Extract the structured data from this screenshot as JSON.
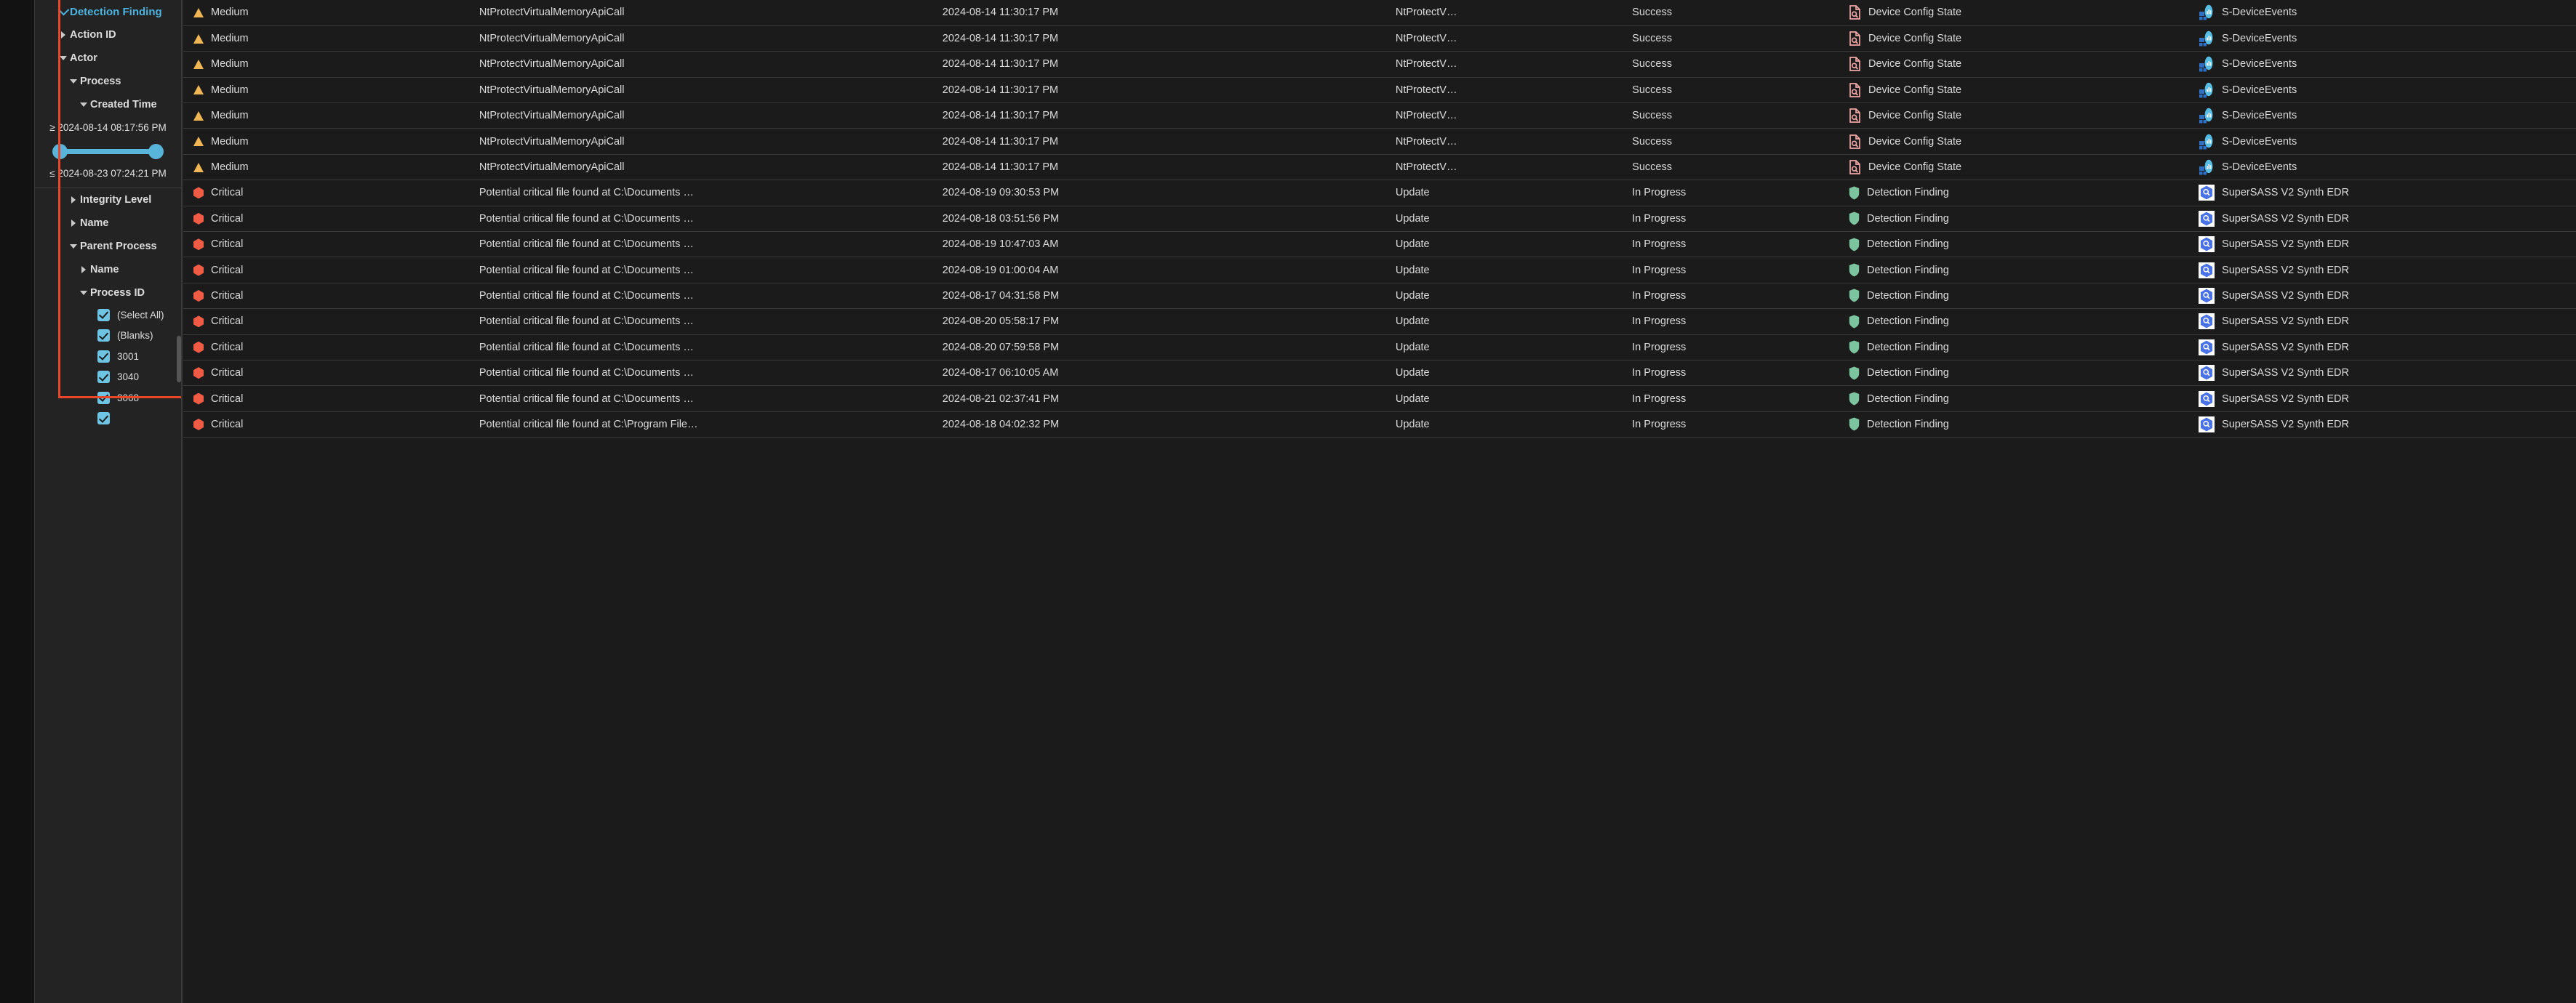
{
  "sidebar": {
    "tree": [
      {
        "id": "detection-finding",
        "label": "Detection Finding",
        "state": "expanded-root",
        "indent": 0
      },
      {
        "id": "action-id",
        "label": "Action ID",
        "state": "collapsed",
        "indent": 0
      },
      {
        "id": "actor",
        "label": "Actor",
        "state": "expanded",
        "indent": 0
      },
      {
        "id": "process",
        "label": "Process",
        "state": "expanded",
        "indent": 1
      },
      {
        "id": "created-time",
        "label": "Created Time",
        "state": "expanded",
        "indent": 2
      }
    ],
    "date_filter": {
      "min_label": "≥ 2024-08-14 08:17:56 PM",
      "max_label": "≤ 2024-08-23 07:24:21 PM"
    },
    "tree_after": [
      {
        "id": "integrity-level",
        "label": "Integrity Level",
        "state": "collapsed",
        "indent": 1
      },
      {
        "id": "name",
        "label": "Name",
        "state": "collapsed",
        "indent": 1
      },
      {
        "id": "parent-process",
        "label": "Parent Process",
        "state": "expanded",
        "indent": 1
      },
      {
        "id": "parent-name",
        "label": "Name",
        "state": "collapsed",
        "indent": 2
      },
      {
        "id": "process-id",
        "label": "Process ID",
        "state": "expanded",
        "indent": 2
      }
    ],
    "process_id_options": [
      {
        "label": "(Select All)",
        "checked": true
      },
      {
        "label": "(Blanks)",
        "checked": true
      },
      {
        "label": "3001",
        "checked": true
      },
      {
        "label": "3040",
        "checked": true
      },
      {
        "label": "3068",
        "checked": true
      },
      {
        "label": "",
        "checked": true
      }
    ],
    "accent_color": "#4bb3e0",
    "highlight_color": "#e8452a"
  },
  "table": {
    "rows": [
      {
        "severity": "Medium",
        "sev_icon": "warning-triangle-icon",
        "title": "NtProtectVirtualMemoryApiCall",
        "time": "2024-08-14 11:30:17 PM",
        "activity": "NtProtectV…",
        "status": "Success",
        "finding_type": "Device Config State",
        "type_icon": "document-search-icon",
        "product": "S-DeviceEvents",
        "product_icon": "chart-tiles-icon"
      },
      {
        "severity": "Medium",
        "sev_icon": "warning-triangle-icon",
        "title": "NtProtectVirtualMemoryApiCall",
        "time": "2024-08-14 11:30:17 PM",
        "activity": "NtProtectV…",
        "status": "Success",
        "finding_type": "Device Config State",
        "type_icon": "document-search-icon",
        "product": "S-DeviceEvents",
        "product_icon": "chart-tiles-icon"
      },
      {
        "severity": "Medium",
        "sev_icon": "warning-triangle-icon",
        "title": "NtProtectVirtualMemoryApiCall",
        "time": "2024-08-14 11:30:17 PM",
        "activity": "NtProtectV…",
        "status": "Success",
        "finding_type": "Device Config State",
        "type_icon": "document-search-icon",
        "product": "S-DeviceEvents",
        "product_icon": "chart-tiles-icon"
      },
      {
        "severity": "Medium",
        "sev_icon": "warning-triangle-icon",
        "title": "NtProtectVirtualMemoryApiCall",
        "time": "2024-08-14 11:30:17 PM",
        "activity": "NtProtectV…",
        "status": "Success",
        "finding_type": "Device Config State",
        "type_icon": "document-search-icon",
        "product": "S-DeviceEvents",
        "product_icon": "chart-tiles-icon"
      },
      {
        "severity": "Medium",
        "sev_icon": "warning-triangle-icon",
        "title": "NtProtectVirtualMemoryApiCall",
        "time": "2024-08-14 11:30:17 PM",
        "activity": "NtProtectV…",
        "status": "Success",
        "finding_type": "Device Config State",
        "type_icon": "document-search-icon",
        "product": "S-DeviceEvents",
        "product_icon": "chart-tiles-icon"
      },
      {
        "severity": "Medium",
        "sev_icon": "warning-triangle-icon",
        "title": "NtProtectVirtualMemoryApiCall",
        "time": "2024-08-14 11:30:17 PM",
        "activity": "NtProtectV…",
        "status": "Success",
        "finding_type": "Device Config State",
        "type_icon": "document-search-icon",
        "product": "S-DeviceEvents",
        "product_icon": "chart-tiles-icon"
      },
      {
        "severity": "Medium",
        "sev_icon": "warning-triangle-icon",
        "title": "NtProtectVirtualMemoryApiCall",
        "time": "2024-08-14 11:30:17 PM",
        "activity": "NtProtectV…",
        "status": "Success",
        "finding_type": "Device Config State",
        "type_icon": "document-search-icon",
        "product": "S-DeviceEvents",
        "product_icon": "chart-tiles-icon"
      },
      {
        "severity": "Critical",
        "sev_icon": "critical-hex-icon",
        "title": "Potential critical file found at C:\\Documents …",
        "time": "2024-08-19 09:30:53 PM",
        "activity": "Update",
        "status": "In Progress",
        "finding_type": "Detection Finding",
        "type_icon": "shield-icon",
        "product": "SuperSASS V2 Synth EDR",
        "product_icon": "hex-search-icon"
      },
      {
        "severity": "Critical",
        "sev_icon": "critical-hex-icon",
        "title": "Potential critical file found at C:\\Documents …",
        "time": "2024-08-18 03:51:56 PM",
        "activity": "Update",
        "status": "In Progress",
        "finding_type": "Detection Finding",
        "type_icon": "shield-icon",
        "product": "SuperSASS V2 Synth EDR",
        "product_icon": "hex-search-icon"
      },
      {
        "severity": "Critical",
        "sev_icon": "critical-hex-icon",
        "title": "Potential critical file found at C:\\Documents …",
        "time": "2024-08-19 10:47:03 AM",
        "activity": "Update",
        "status": "In Progress",
        "finding_type": "Detection Finding",
        "type_icon": "shield-icon",
        "product": "SuperSASS V2 Synth EDR",
        "product_icon": "hex-search-icon"
      },
      {
        "severity": "Critical",
        "sev_icon": "critical-hex-icon",
        "title": "Potential critical file found at C:\\Documents …",
        "time": "2024-08-19 01:00:04 AM",
        "activity": "Update",
        "status": "In Progress",
        "finding_type": "Detection Finding",
        "type_icon": "shield-icon",
        "product": "SuperSASS V2 Synth EDR",
        "product_icon": "hex-search-icon"
      },
      {
        "severity": "Critical",
        "sev_icon": "critical-hex-icon",
        "title": "Potential critical file found at C:\\Documents …",
        "time": "2024-08-17 04:31:58 PM",
        "activity": "Update",
        "status": "In Progress",
        "finding_type": "Detection Finding",
        "type_icon": "shield-icon",
        "product": "SuperSASS V2 Synth EDR",
        "product_icon": "hex-search-icon"
      },
      {
        "severity": "Critical",
        "sev_icon": "critical-hex-icon",
        "title": "Potential critical file found at C:\\Documents …",
        "time": "2024-08-20 05:58:17 PM",
        "activity": "Update",
        "status": "In Progress",
        "finding_type": "Detection Finding",
        "type_icon": "shield-icon",
        "product": "SuperSASS V2 Synth EDR",
        "product_icon": "hex-search-icon"
      },
      {
        "severity": "Critical",
        "sev_icon": "critical-hex-icon",
        "title": "Potential critical file found at C:\\Documents …",
        "time": "2024-08-20 07:59:58 PM",
        "activity": "Update",
        "status": "In Progress",
        "finding_type": "Detection Finding",
        "type_icon": "shield-icon",
        "product": "SuperSASS V2 Synth EDR",
        "product_icon": "hex-search-icon"
      },
      {
        "severity": "Critical",
        "sev_icon": "critical-hex-icon",
        "title": "Potential critical file found at C:\\Documents …",
        "time": "2024-08-17 06:10:05 AM",
        "activity": "Update",
        "status": "In Progress",
        "finding_type": "Detection Finding",
        "type_icon": "shield-icon",
        "product": "SuperSASS V2 Synth EDR",
        "product_icon": "hex-search-icon"
      },
      {
        "severity": "Critical",
        "sev_icon": "critical-hex-icon",
        "title": "Potential critical file found at C:\\Documents …",
        "time": "2024-08-21 02:37:41 PM",
        "activity": "Update",
        "status": "In Progress",
        "finding_type": "Detection Finding",
        "type_icon": "shield-icon",
        "product": "SuperSASS V2 Synth EDR",
        "product_icon": "hex-search-icon"
      },
      {
        "severity": "Critical",
        "sev_icon": "critical-hex-icon",
        "title": "Potential critical file found at C:\\Program File…",
        "time": "2024-08-18 04:02:32 PM",
        "activity": "Update",
        "status": "In Progress",
        "finding_type": "Detection Finding",
        "type_icon": "shield-icon",
        "product": "SuperSASS V2 Synth EDR",
        "product_icon": "hex-search-icon"
      }
    ],
    "colors": {
      "medium": "#f0b654",
      "critical": "#ef5b45",
      "timestamp": "#6fc6e8",
      "shield": "#7cc3a0",
      "doc": "#f2a7a7"
    }
  }
}
